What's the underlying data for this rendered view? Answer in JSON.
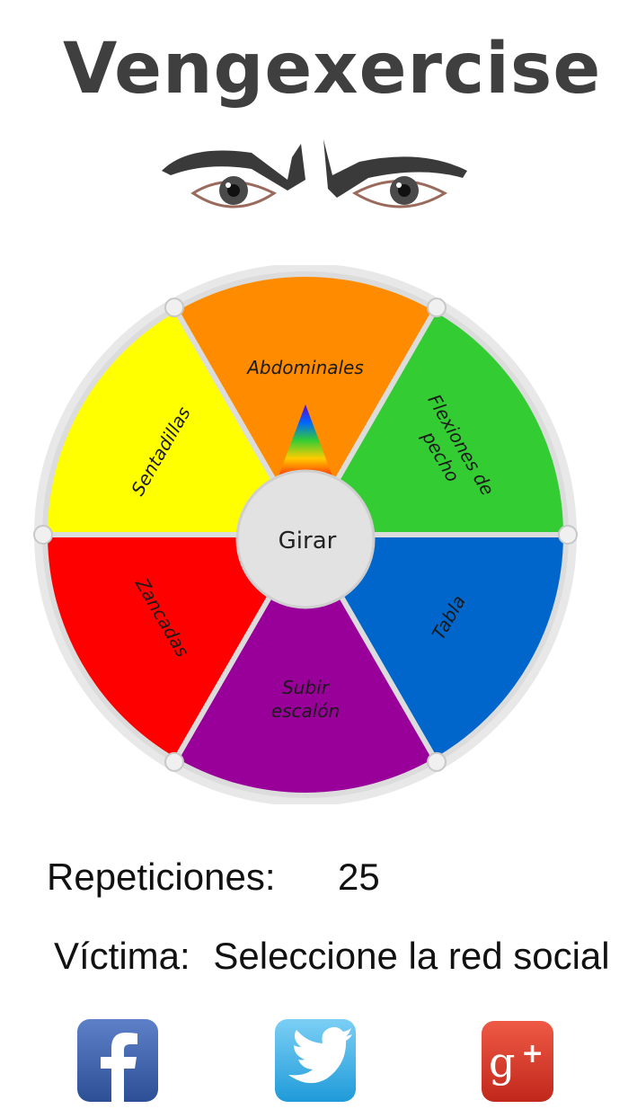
{
  "app": {
    "title": "Vengexercise"
  },
  "wheel": {
    "center_button": "Girar",
    "segments": [
      {
        "label": "Abdominales",
        "color": "#ff8c00"
      },
      {
        "label": "Flexiones de pecho",
        "color": "#33cc33"
      },
      {
        "label": "Tabla",
        "color": "#0066cc"
      },
      {
        "label": "Subir escalón",
        "color": "#990099"
      },
      {
        "label": "Zancadas",
        "color": "#ff0000"
      },
      {
        "label": "Sentadillas",
        "color": "#ffff00"
      }
    ]
  },
  "stats": {
    "repetitions_label": "Repeticiones:",
    "repetitions_value": "25",
    "victim_label": "Víctima:",
    "victim_value": "Seleccione la red social"
  },
  "social": [
    {
      "name": "facebook",
      "icon": "facebook-icon"
    },
    {
      "name": "twitter",
      "icon": "twitter-icon"
    },
    {
      "name": "googleplus",
      "icon": "google-plus-icon"
    }
  ]
}
